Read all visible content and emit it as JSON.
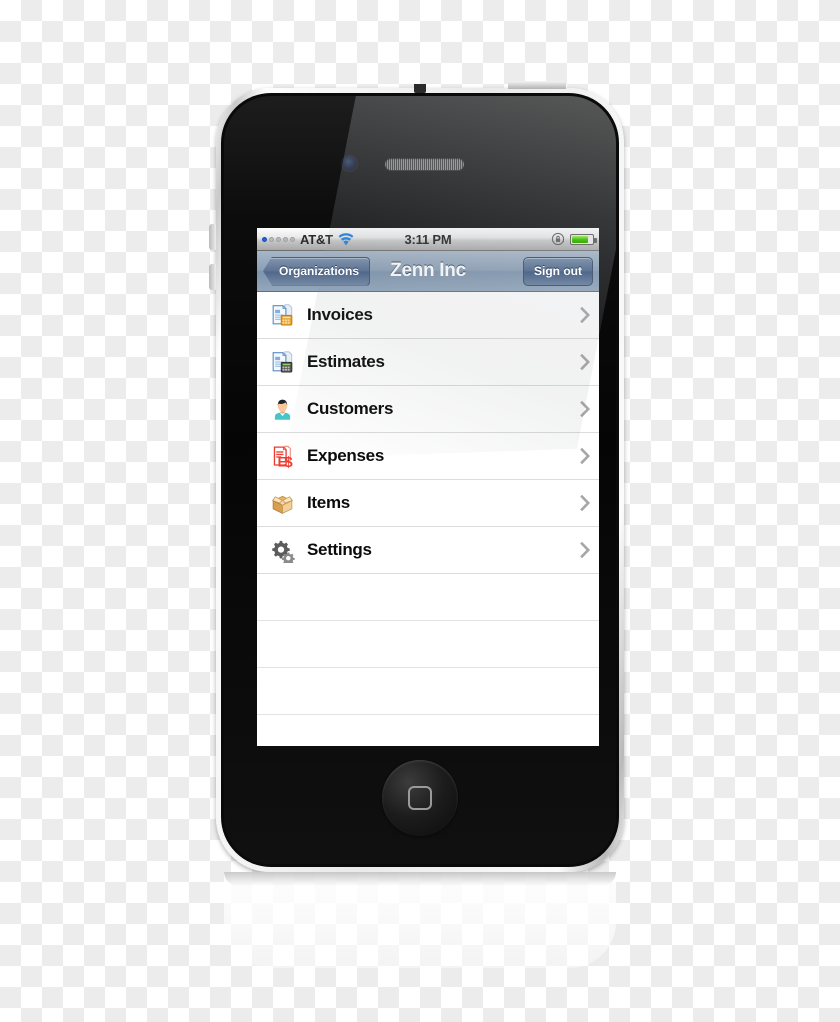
{
  "device": {
    "name": "iPhone 4",
    "hardware": {
      "front_camera": "camera-icon",
      "earpiece": "earpiece-speaker",
      "home_button": "home-button",
      "power_button": "power-button",
      "volume_up": "volume-up-button",
      "volume_down": "volume-down-button"
    }
  },
  "status_bar": {
    "carrier": "AT&T",
    "signal_bars_filled": 1,
    "signal_bars_total": 5,
    "wifi_icon": "wifi-icon",
    "time": "3:11 PM",
    "rotation_lock_icon": "rotation-lock-icon",
    "battery_icon": "battery-icon",
    "battery_level_percent": 78,
    "battery_color": "#49bd13"
  },
  "nav_bar": {
    "back_label": "Organizations",
    "title": "Zenn Inc",
    "action_label": "Sign out",
    "tint_color": "#7e94ad"
  },
  "menu": {
    "items": [
      {
        "label": "Invoices",
        "icon": "invoice-document-icon",
        "accessory": "chevron-right-icon"
      },
      {
        "label": "Estimates",
        "icon": "estimate-document-icon",
        "accessory": "chevron-right-icon"
      },
      {
        "label": "Customers",
        "icon": "customer-person-icon",
        "accessory": "chevron-right-icon"
      },
      {
        "label": "Expenses",
        "icon": "expense-receipt-icon",
        "accessory": "chevron-right-icon"
      },
      {
        "label": "Items",
        "icon": "items-box-icon",
        "accessory": "chevron-right-icon"
      },
      {
        "label": "Settings",
        "icon": "settings-gears-icon",
        "accessory": "chevron-right-icon"
      }
    ],
    "empty_rows": 3
  }
}
